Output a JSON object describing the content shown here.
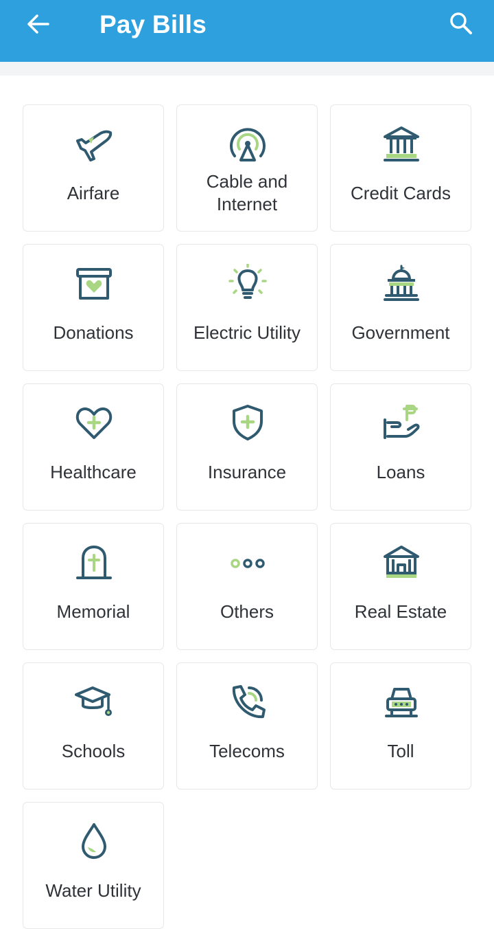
{
  "header": {
    "title": "Pay Bills",
    "back_icon": "arrow-left-icon",
    "search_icon": "search-icon"
  },
  "colors": {
    "appbar": "#2ea0de",
    "icon_primary": "#2f5a6f",
    "icon_accent": "#a8d683",
    "card_border": "#e6e7ea"
  },
  "categories": [
    {
      "label": "Airfare",
      "icon": "airplane-icon"
    },
    {
      "label": "Cable and Internet",
      "icon": "antenna-icon"
    },
    {
      "label": "Credit Cards",
      "icon": "bank-icon"
    },
    {
      "label": "Donations",
      "icon": "donation-box-icon"
    },
    {
      "label": "Electric Utility",
      "icon": "lightbulb-icon"
    },
    {
      "label": "Government",
      "icon": "capitol-building-icon"
    },
    {
      "label": "Healthcare",
      "icon": "heart-plus-icon"
    },
    {
      "label": "Insurance",
      "icon": "shield-plus-icon"
    },
    {
      "label": "Loans",
      "icon": "hand-peso-icon"
    },
    {
      "label": "Memorial",
      "icon": "tombstone-icon"
    },
    {
      "label": "Others",
      "icon": "more-dots-icon"
    },
    {
      "label": "Real Estate",
      "icon": "house-building-icon"
    },
    {
      "label": "Schools",
      "icon": "graduation-cap-icon"
    },
    {
      "label": "Telecoms",
      "icon": "phone-icon"
    },
    {
      "label": "Toll",
      "icon": "car-icon"
    },
    {
      "label": "Water Utility",
      "icon": "water-drop-icon"
    }
  ]
}
